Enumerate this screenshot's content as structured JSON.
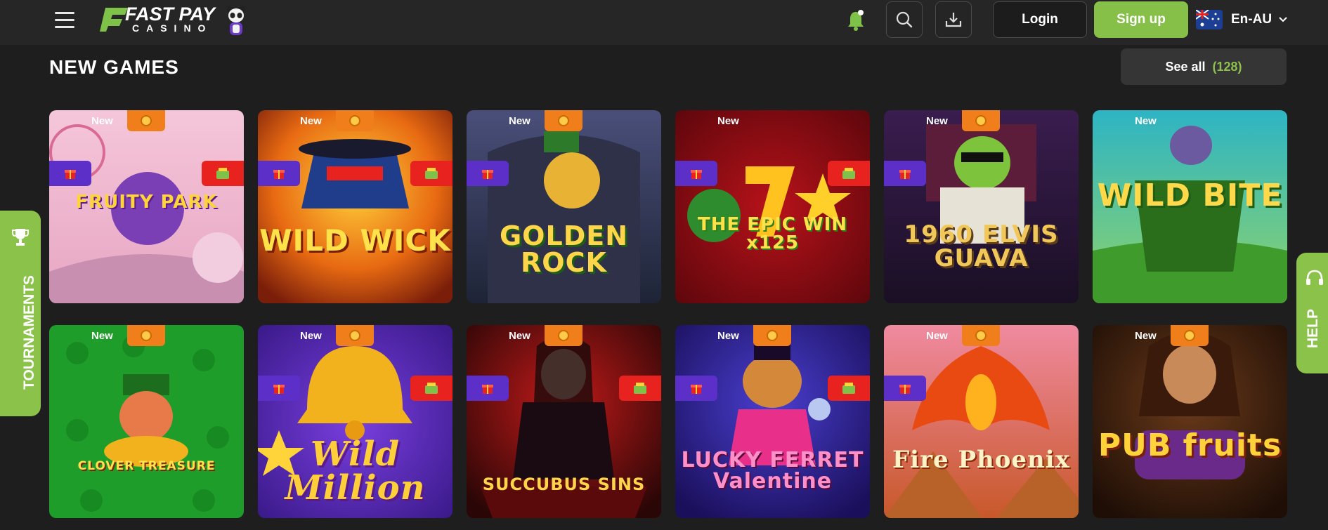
{
  "header": {
    "logo_text": "FAST PAY",
    "logo_sub": "CASINO",
    "login_label": "Login",
    "signup_label": "Sign up",
    "language": "En-AU"
  },
  "section": {
    "title": "NEW GAMES",
    "see_all_label": "See all",
    "see_all_count": "(128)"
  },
  "games": [
    {
      "title": "FRUITY PARK",
      "badge": "New"
    },
    {
      "title": "WILD WICK",
      "badge": "New"
    },
    {
      "title": "GOLDEN ROCK",
      "badge": "New"
    },
    {
      "title": "THE EPIC WIN x125",
      "badge": "New"
    },
    {
      "title": "1960 ELVIS GUAVA",
      "badge": "New"
    },
    {
      "title": "WILD BITE",
      "badge": "New"
    },
    {
      "title": "CLOVER TREASURE",
      "badge": "New"
    },
    {
      "title": "Wild Million",
      "badge": "New"
    },
    {
      "title": "SUCCUBUS SINS",
      "badge": "New"
    },
    {
      "title": "LUCKY FERRET Valentine",
      "badge": "New"
    },
    {
      "title": "Fire Phoenix",
      "badge": "New"
    },
    {
      "title": "PUB fruits",
      "badge": "New"
    }
  ],
  "side": {
    "tournaments_label": "TOURNAMENTS",
    "help_label": "HELP"
  },
  "colors": {
    "accent_green": "#86c048",
    "coin_orange": "#f07e1b",
    "gift_purple": "#5c2fc9",
    "wallet_red": "#e8221f",
    "background": "#1e1e1e"
  }
}
